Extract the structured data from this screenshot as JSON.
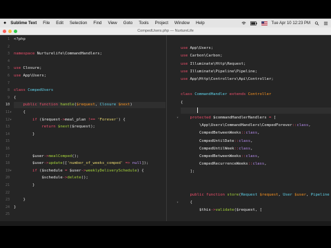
{
  "menubar": {
    "app_name": "Sublime Text",
    "items": [
      "File",
      "Edit",
      "Selection",
      "Find",
      "View",
      "Goto",
      "Tools",
      "Project",
      "Window",
      "Help"
    ],
    "clock": "Tue Apr 10  12:23 PM",
    "icons": [
      "apple-icon",
      "wifi-icon",
      "battery-icon",
      "flag-icon",
      "search-icon",
      "list-icon"
    ]
  },
  "window": {
    "title": "CompedUsers.php — NurtureLife"
  },
  "status": {
    "left": "",
    "right": ""
  },
  "left_pane": {
    "rows": [
      {
        "n": "1",
        "parts": [
          {
            "c": "p",
            "t": "<?php"
          }
        ]
      },
      {
        "n": "2",
        "parts": []
      },
      {
        "n": "3",
        "parts": [
          {
            "c": "k",
            "t": "namespace"
          },
          {
            "c": "v",
            "t": " Nurturelife\\CommandHandlers"
          },
          {
            "c": "p",
            "t": ";"
          }
        ]
      },
      {
        "n": "4",
        "parts": []
      },
      {
        "n": "5",
        "parts": [
          {
            "c": "k",
            "t": "use"
          },
          {
            "c": "v",
            "t": " Closure"
          },
          {
            "c": "p",
            "t": ";"
          }
        ]
      },
      {
        "n": "6",
        "parts": [
          {
            "c": "k",
            "t": "use"
          },
          {
            "c": "v",
            "t": " App\\Users"
          },
          {
            "c": "p",
            "t": ";"
          }
        ]
      },
      {
        "n": "7",
        "parts": []
      },
      {
        "n": "8",
        "parts": [
          {
            "c": "k",
            "t": "class"
          },
          {
            "c": "t",
            "t": " CompedUsers"
          }
        ]
      },
      {
        "n": "9",
        "parts": [
          {
            "c": "p",
            "t": "{"
          }
        ]
      },
      {
        "n": "10",
        "parts": [
          {
            "c": "p",
            "t": "    "
          },
          {
            "c": "k",
            "t": "public function"
          },
          {
            "c": "f",
            "t": " handle"
          },
          {
            "c": "p",
            "t": "("
          },
          {
            "c": "o",
            "t": "$request"
          },
          {
            "c": "p",
            "t": ", "
          },
          {
            "c": "t",
            "t": "Closure"
          },
          {
            "c": "o",
            "t": " $next"
          },
          {
            "c": "p",
            "t": ")"
          }
        ]
      },
      {
        "n": "11",
        "parts": [
          {
            "c": "p",
            "t": "    {"
          }
        ]
      },
      {
        "n": "12",
        "parts": [
          {
            "c": "p",
            "t": "        "
          },
          {
            "c": "k",
            "t": "if"
          },
          {
            "c": "p",
            "t": " ("
          },
          {
            "c": "v",
            "t": "$request"
          },
          {
            "c": "k",
            "t": "->"
          },
          {
            "c": "v",
            "t": "meal_plan"
          },
          {
            "c": "k",
            "t": " !== "
          },
          {
            "c": "s",
            "t": "'Forever'"
          },
          {
            "c": "p",
            "t": ") {"
          }
        ]
      },
      {
        "n": "13",
        "parts": [
          {
            "c": "p",
            "t": "            "
          },
          {
            "c": "k",
            "t": "return"
          },
          {
            "c": "f",
            "t": " $next"
          },
          {
            "c": "p",
            "t": "("
          },
          {
            "c": "v",
            "t": "$request"
          },
          {
            "c": "p",
            "t": ");"
          }
        ]
      },
      {
        "n": "14",
        "parts": [
          {
            "c": "p",
            "t": "        }"
          }
        ]
      },
      {
        "n": "15",
        "parts": []
      },
      {
        "n": "16",
        "parts": []
      },
      {
        "n": "17",
        "parts": [
          {
            "c": "p",
            "t": "        "
          },
          {
            "c": "v",
            "t": "$user"
          },
          {
            "c": "k",
            "t": "->"
          },
          {
            "c": "f",
            "t": "mealComped"
          },
          {
            "c": "p",
            "t": "();"
          }
        ]
      },
      {
        "n": "18",
        "parts": [
          {
            "c": "p",
            "t": "        "
          },
          {
            "c": "v",
            "t": "$user"
          },
          {
            "c": "k",
            "t": "->"
          },
          {
            "c": "f",
            "t": "update"
          },
          {
            "c": "p",
            "t": "(["
          },
          {
            "c": "s",
            "t": "'number_of_weeks_comped'"
          },
          {
            "c": "k",
            "t": " => "
          },
          {
            "c": "n",
            "t": "null"
          },
          {
            "c": "p",
            "t": "]);"
          }
        ]
      },
      {
        "n": "19",
        "parts": [
          {
            "c": "p",
            "t": "        "
          },
          {
            "c": "k",
            "t": "if"
          },
          {
            "c": "p",
            "t": " ("
          },
          {
            "c": "v",
            "t": "$schedule"
          },
          {
            "c": "k",
            "t": " = "
          },
          {
            "c": "v",
            "t": "$user"
          },
          {
            "c": "k",
            "t": "->"
          },
          {
            "c": "f",
            "t": "weeklyDeliverySchedule"
          },
          {
            "c": "p",
            "t": ") {"
          }
        ]
      },
      {
        "n": "20",
        "parts": [
          {
            "c": "p",
            "t": "            "
          },
          {
            "c": "v",
            "t": "$schedule"
          },
          {
            "c": "k",
            "t": "->"
          },
          {
            "c": "f",
            "t": "delete"
          },
          {
            "c": "p",
            "t": "();"
          }
        ]
      },
      {
        "n": "21",
        "parts": [
          {
            "c": "p",
            "t": "        }"
          }
        ]
      },
      {
        "n": "22",
        "parts": []
      },
      {
        "n": "23",
        "parts": [
          {
            "c": "p",
            "t": "    }"
          }
        ]
      },
      {
        "n": "24",
        "parts": [
          {
            "c": "p",
            "t": "}"
          }
        ]
      },
      {
        "n": "25",
        "parts": []
      }
    ]
  },
  "right_pane": {
    "rows": [
      {
        "n": "",
        "parts": []
      },
      {
        "n": "",
        "parts": [
          {
            "c": "k",
            "t": "use"
          },
          {
            "c": "v",
            "t": " App\\Users"
          },
          {
            "c": "p",
            "t": ";"
          }
        ]
      },
      {
        "n": "",
        "parts": [
          {
            "c": "k",
            "t": "use"
          },
          {
            "c": "v",
            "t": " Carbon\\Carbon"
          },
          {
            "c": "p",
            "t": ";"
          }
        ]
      },
      {
        "n": "",
        "parts": [
          {
            "c": "k",
            "t": "use"
          },
          {
            "c": "v",
            "t": " Illuminate\\Http\\Request"
          },
          {
            "c": "p",
            "t": ";"
          }
        ]
      },
      {
        "n": "",
        "parts": [
          {
            "c": "k",
            "t": "use"
          },
          {
            "c": "v",
            "t": " Illuminate\\Pipeline\\Pipeline"
          },
          {
            "c": "p",
            "t": ";"
          }
        ]
      },
      {
        "n": "",
        "parts": [
          {
            "c": "k",
            "t": "use"
          },
          {
            "c": "v",
            "t": " App\\Http\\Controllers\\Api\\Controller"
          },
          {
            "c": "p",
            "t": ";"
          }
        ]
      },
      {
        "n": "",
        "parts": []
      },
      {
        "n": "",
        "parts": [
          {
            "c": "k",
            "t": "class"
          },
          {
            "c": "t",
            "t": " CommandHandler"
          },
          {
            "c": "k",
            "t": " extends"
          },
          {
            "c": "o",
            "t": " Controller"
          }
        ]
      },
      {
        "n": "",
        "parts": [
          {
            "c": "p",
            "t": "{"
          }
        ]
      },
      {
        "n": "",
        "parts": []
      },
      {
        "n": "",
        "parts": [
          {
            "c": "p",
            "t": "    "
          },
          {
            "c": "k",
            "t": "protected"
          },
          {
            "c": "v",
            "t": " $commandHandlerHandlers"
          },
          {
            "c": "k",
            "t": " = "
          },
          {
            "c": "p",
            "t": "["
          }
        ]
      },
      {
        "n": "",
        "parts": [
          {
            "c": "p",
            "t": "        "
          },
          {
            "c": "v",
            "t": "\\App\\Users\\CommandHandlers\\CompedForever"
          },
          {
            "c": "k",
            "t": "::"
          },
          {
            "c": "n",
            "t": "class"
          },
          {
            "c": "p",
            "t": ","
          }
        ]
      },
      {
        "n": "",
        "parts": [
          {
            "c": "p",
            "t": "        "
          },
          {
            "c": "v",
            "t": "CompedBetweenWeeks"
          },
          {
            "c": "k",
            "t": "::"
          },
          {
            "c": "n",
            "t": "class"
          },
          {
            "c": "p",
            "t": ","
          }
        ]
      },
      {
        "n": "",
        "parts": [
          {
            "c": "p",
            "t": "        "
          },
          {
            "c": "v",
            "t": "CompedUntilDate"
          },
          {
            "c": "k",
            "t": "::"
          },
          {
            "c": "n",
            "t": "class"
          },
          {
            "c": "p",
            "t": ","
          }
        ]
      },
      {
        "n": "",
        "parts": [
          {
            "c": "p",
            "t": "        "
          },
          {
            "c": "v",
            "t": "CompedUntilWeek"
          },
          {
            "c": "k",
            "t": "::"
          },
          {
            "c": "n",
            "t": "class"
          },
          {
            "c": "p",
            "t": ","
          }
        ]
      },
      {
        "n": "",
        "parts": [
          {
            "c": "p",
            "t": "        "
          },
          {
            "c": "v",
            "t": "CompedBetweenWeeks"
          },
          {
            "c": "k",
            "t": "::"
          },
          {
            "c": "n",
            "t": "class"
          },
          {
            "c": "p",
            "t": ","
          }
        ]
      },
      {
        "n": "",
        "parts": [
          {
            "c": "p",
            "t": "        "
          },
          {
            "c": "v",
            "t": "CompedRecurrenceWeeks"
          },
          {
            "c": "k",
            "t": "::"
          },
          {
            "c": "n",
            "t": "class"
          },
          {
            "c": "p",
            "t": ","
          }
        ]
      },
      {
        "n": "",
        "parts": [
          {
            "c": "p",
            "t": "    ];"
          }
        ]
      },
      {
        "n": "",
        "parts": []
      },
      {
        "n": "",
        "parts": []
      },
      {
        "n": "",
        "parts": [
          {
            "c": "p",
            "t": "    "
          },
          {
            "c": "k",
            "t": "public function"
          },
          {
            "c": "f",
            "t": " store"
          },
          {
            "c": "p",
            "t": "("
          },
          {
            "c": "t",
            "t": "Request"
          },
          {
            "c": "o",
            "t": " $request"
          },
          {
            "c": "p",
            "t": ", "
          },
          {
            "c": "t",
            "t": "User"
          },
          {
            "c": "o",
            "t": " $user"
          },
          {
            "c": "p",
            "t": ", "
          },
          {
            "c": "t",
            "t": "Pipeline"
          },
          {
            "c": "o",
            "t": " $pipe"
          }
        ]
      },
      {
        "n": "",
        "parts": [
          {
            "c": "p",
            "t": "    {"
          }
        ]
      },
      {
        "n": "",
        "parts": [
          {
            "c": "p",
            "t": "        "
          },
          {
            "c": "v",
            "t": "$this"
          },
          {
            "c": "k",
            "t": "->"
          },
          {
            "c": "f",
            "t": "validate"
          },
          {
            "c": "p",
            "t": "("
          },
          {
            "c": "v",
            "t": "$request"
          },
          {
            "c": "p",
            "t": ", ["
          }
        ]
      }
    ]
  }
}
